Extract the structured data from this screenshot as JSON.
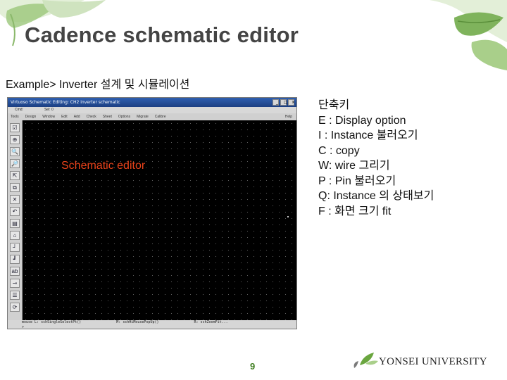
{
  "slide": {
    "title": "Cadence schematic editor",
    "subtitle": "Example> Inverter 설계 및 시뮬레이션",
    "page_number": "9"
  },
  "cadence_window": {
    "title": "Virtuoso Schematic Editing: CH2 inverter schematic",
    "status": [
      "Cmd:",
      "Sel: 0"
    ],
    "menu": [
      "Tools",
      "Design",
      "Window",
      "Edit",
      "Add",
      "Check",
      "Sheet",
      "Options",
      "Migrate",
      "Calibre"
    ],
    "help": "Help",
    "canvas_label": "Schematic editor",
    "bottom_status": [
      "mouse L: schSingleSelectPt()",
      "M: schHiMousePopUp()",
      "R: schZoomFit..."
    ],
    "prompt": ">"
  },
  "shortcuts": {
    "heading": "단축키",
    "items": [
      "E : Display option",
      "I : Instance 불러오기",
      "C : copy",
      "W: wire 그리기",
      "P : Pin 불러오기",
      "Q: Instance 의 상태보기",
      "F : 화면 크기 fit"
    ]
  },
  "logo": {
    "text": "YONSEI UNIVERSITY"
  },
  "colors": {
    "canvas_label": "#e8421a",
    "page_number": "#3e7d1f",
    "canvas_bg": "#000000"
  }
}
